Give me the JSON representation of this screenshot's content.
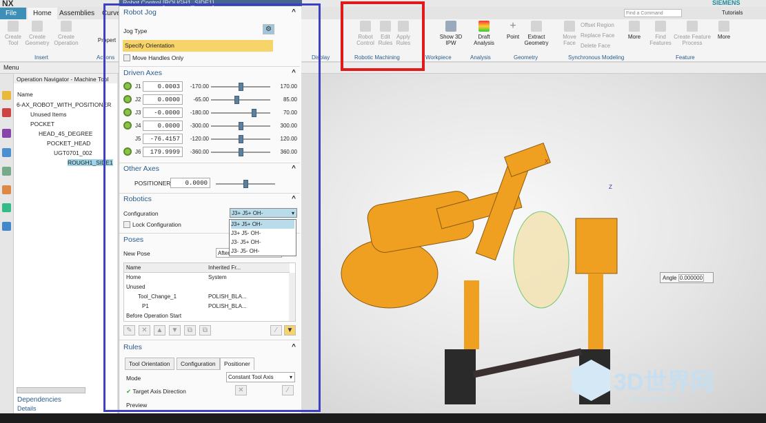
{
  "app": {
    "name": "NX",
    "brand": "SIEMENS",
    "find_placeholder": "Find a Command",
    "tutorials": "Tutorials"
  },
  "tabs": [
    "File",
    "Home",
    "Assemblies",
    "Curve"
  ],
  "ribbon": {
    "buttons": [
      {
        "label": "Create Tool"
      },
      {
        "label": "Create Geometry"
      },
      {
        "label": "Create Operation"
      },
      {
        "label": "Propert"
      },
      {
        "label": "Robot Control"
      },
      {
        "label": "Edit Rules"
      },
      {
        "label": "Apply Rules"
      },
      {
        "label": "Show 3D IPW"
      },
      {
        "label": "Draft Analysis"
      },
      {
        "label": "Point"
      },
      {
        "label": "Extract Geometry"
      },
      {
        "label": "Move Face"
      },
      {
        "label": "Offset Region"
      },
      {
        "label": "Replace Face"
      },
      {
        "label": "Delete Face"
      },
      {
        "label": "More"
      },
      {
        "label": "Find Features"
      },
      {
        "label": "Create Feature Process"
      },
      {
        "label": "More"
      }
    ],
    "groups": [
      "Insert",
      "Actions",
      "Display",
      "Robotic Machining",
      "Workpiece",
      "Analysis",
      "Geometry",
      "Synchronous Modeling",
      "Feature"
    ]
  },
  "toolbar": {
    "menu": "Menu"
  },
  "navigator": {
    "title": "Operation Navigator - Machine Tool",
    "column": "Name",
    "rows": [
      "6-AX_ROBOT_WITH_POSITIONER",
      "Unused Items",
      "POCKET",
      "HEAD_45_DEGREE",
      "POCKET_HEAD",
      "UGT0701_002",
      "ROUGH1_SIDE1"
    ],
    "dependencies": "Dependencies",
    "details": "Details"
  },
  "dialog": {
    "title": "Robot Control [ROUGH1_SIDE1]",
    "robot_jog": {
      "header": "Robot Jog",
      "jog_type": "Jog Type",
      "specify_orientation": "Specify Orientation",
      "move_handles_only": "Move Handles Only"
    },
    "driven_axes": {
      "header": "Driven Axes",
      "joints": [
        {
          "name": "J1",
          "value": "0.0003",
          "min": "-170.00",
          "max": "170.00",
          "pos": 0.5
        },
        {
          "name": "J2",
          "value": "0.0000",
          "min": "-65.00",
          "max": "85.00",
          "pos": 0.43
        },
        {
          "name": "J3",
          "value": "-0.0000",
          "min": "-180.00",
          "max": "70.00",
          "pos": 0.72
        },
        {
          "name": "J4",
          "value": "0.0000",
          "min": "-300.00",
          "max": "300.00",
          "pos": 0.5
        },
        {
          "name": "J5",
          "value": "-76.4157",
          "min": "-120.00",
          "max": "120.00",
          "pos": 0.5
        },
        {
          "name": "J6",
          "value": "179.9999",
          "min": "-360.00",
          "max": "360.00",
          "pos": 0.5
        }
      ]
    },
    "other_axes": {
      "header": "Other Axes",
      "label": "POSITIONER",
      "value": "0.0000",
      "pos": 0.5
    },
    "robotics": {
      "header": "Robotics",
      "configuration_label": "Configuration",
      "configuration_value": "J3+ J5+ OH-",
      "options": [
        "J3+ J5+ OH-",
        "J3+ J5- OH-",
        "J3- J5+ OH-",
        "J3- J5- OH-"
      ],
      "lock": "Lock Configuration"
    },
    "poses": {
      "header": "Poses",
      "new_pose": "New Pose",
      "new_pose_value": "After Selected",
      "columns": [
        "Name",
        "Inherited Fr..."
      ],
      "rows": [
        {
          "name": "Home",
          "from": "System"
        },
        {
          "name": "Unused",
          "from": ""
        },
        {
          "name": "Tool_Change_1",
          "from": "POLISH_BLA..."
        },
        {
          "name": "P1",
          "from": "POLISH_BLA..."
        },
        {
          "name": "Before Operation Start",
          "from": ""
        }
      ]
    },
    "rules": {
      "header": "Rules",
      "tabs": [
        "Tool Orientation",
        "Configuration",
        "Positioner"
      ],
      "mode_label": "Mode",
      "mode_value": "Constant Tool Axis",
      "target_axis": "Target Axis Direction",
      "preview": "Preview"
    }
  },
  "viewport": {
    "angle_label": "Angle",
    "angle_value": "0.000000",
    "axis_x": "X",
    "axis_z": "Z"
  },
  "watermark": {
    "text": "3D世界网",
    "url": "WWW.3DSJW.COM"
  },
  "colors": {
    "highlight_box": "#3d3fc4",
    "red_box": "#e01a1a",
    "robot": "#f0a020"
  }
}
